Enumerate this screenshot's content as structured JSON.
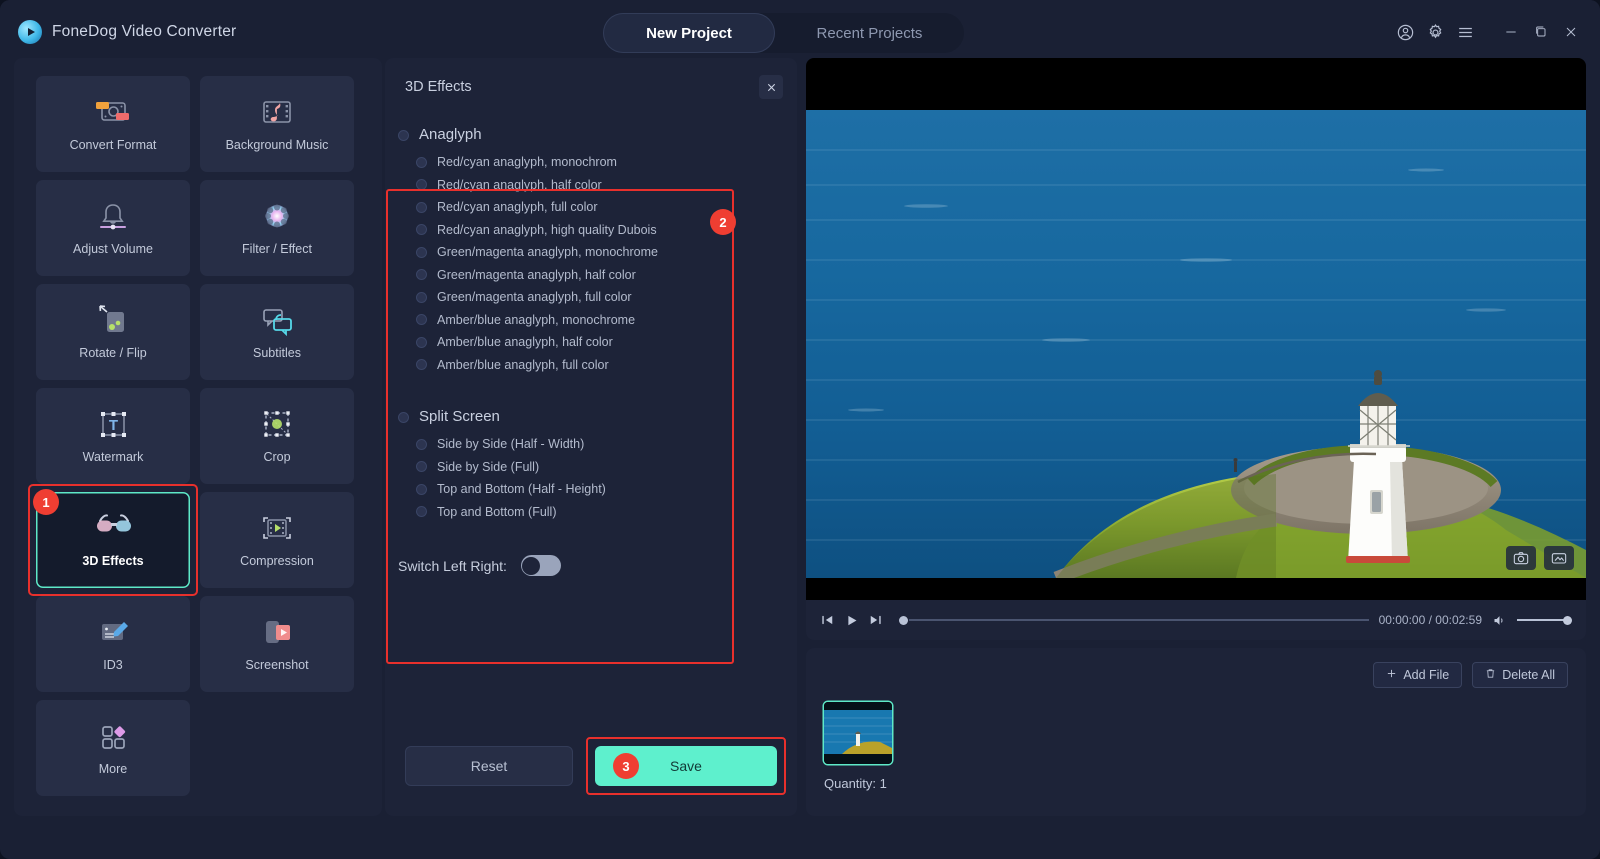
{
  "app": {
    "brand": "FoneDog Video Converter",
    "logo_icon": "play-logo-icon",
    "accent_color": "#5ef0cd",
    "highlight_color": "#e8302c"
  },
  "titlebar": {
    "tabs": [
      {
        "label": "New Project",
        "active": true
      },
      {
        "label": "Recent Projects",
        "active": false
      }
    ],
    "icons": [
      {
        "name": "account-icon"
      },
      {
        "name": "settings-gear-icon"
      },
      {
        "name": "hamburger-menu-icon"
      },
      {
        "name": "minimize-icon"
      },
      {
        "name": "maximize-icon"
      },
      {
        "name": "close-icon"
      }
    ]
  },
  "sidebar": {
    "tiles": [
      {
        "label": "Convert Format",
        "icon": "convert-format-icon",
        "selected": false
      },
      {
        "label": "Background Music",
        "icon": "background-music-icon",
        "selected": false
      },
      {
        "label": "Adjust Volume",
        "icon": "adjust-volume-icon",
        "selected": false
      },
      {
        "label": "Filter / Effect",
        "icon": "filter-effect-icon",
        "selected": false
      },
      {
        "label": "Rotate / Flip",
        "icon": "rotate-flip-icon",
        "selected": false
      },
      {
        "label": "Subtitles",
        "icon": "subtitles-icon",
        "selected": false
      },
      {
        "label": "Watermark",
        "icon": "watermark-icon",
        "selected": false
      },
      {
        "label": "Crop",
        "icon": "crop-icon",
        "selected": false
      },
      {
        "label": "3D Effects",
        "icon": "3d-glasses-icon",
        "selected": true,
        "badge": "1"
      },
      {
        "label": "Compression",
        "icon": "compression-icon",
        "selected": false
      },
      {
        "label": "ID3",
        "icon": "id3-tag-icon",
        "selected": false
      },
      {
        "label": "Screenshot",
        "icon": "screenshot-icon",
        "selected": false
      },
      {
        "label": "More",
        "icon": "more-grid-icon",
        "selected": false
      }
    ]
  },
  "panel": {
    "title": "3D Effects",
    "close_icon": "close-icon",
    "badge": "2",
    "groups": [
      {
        "title": "Anaglyph",
        "options": [
          "Red/cyan anaglyph, monochrom",
          "Red/cyan anaglyph, half color",
          "Red/cyan anaglyph, full color",
          "Red/cyan anaglyph, high quality Dubois",
          "Green/magenta anaglyph, monochrome",
          "Green/magenta anaglyph, half color",
          "Green/magenta anaglyph, full color",
          "Amber/blue anaglyph, monochrome",
          "Amber/blue anaglyph, half color",
          "Amber/blue anaglyph, full color"
        ]
      },
      {
        "title": "Split Screen",
        "options": [
          "Side by Side (Half - Width)",
          "Side by Side (Full)",
          "Top and Bottom (Half - Height)",
          "Top and Bottom (Full)"
        ]
      }
    ],
    "switch": {
      "label": "Switch Left Right:",
      "on": false
    },
    "reset_label": "Reset",
    "save_label": "Save",
    "save_badge": "3"
  },
  "preview": {
    "overlay_buttons": [
      {
        "name": "snapshot-camera-icon"
      },
      {
        "name": "gif-record-icon"
      }
    ],
    "controls": {
      "prev_icon": "skip-previous-icon",
      "play_icon": "play-icon",
      "next_icon": "skip-next-icon",
      "time": "00:00:00 / 00:02:59",
      "volume_icon": "volume-icon"
    }
  },
  "filelist": {
    "add_file_label": "Add File",
    "add_file_icon": "plus-icon",
    "delete_all_label": "Delete All",
    "delete_all_icon": "trash-icon",
    "quantity": "Quantity: 1"
  }
}
